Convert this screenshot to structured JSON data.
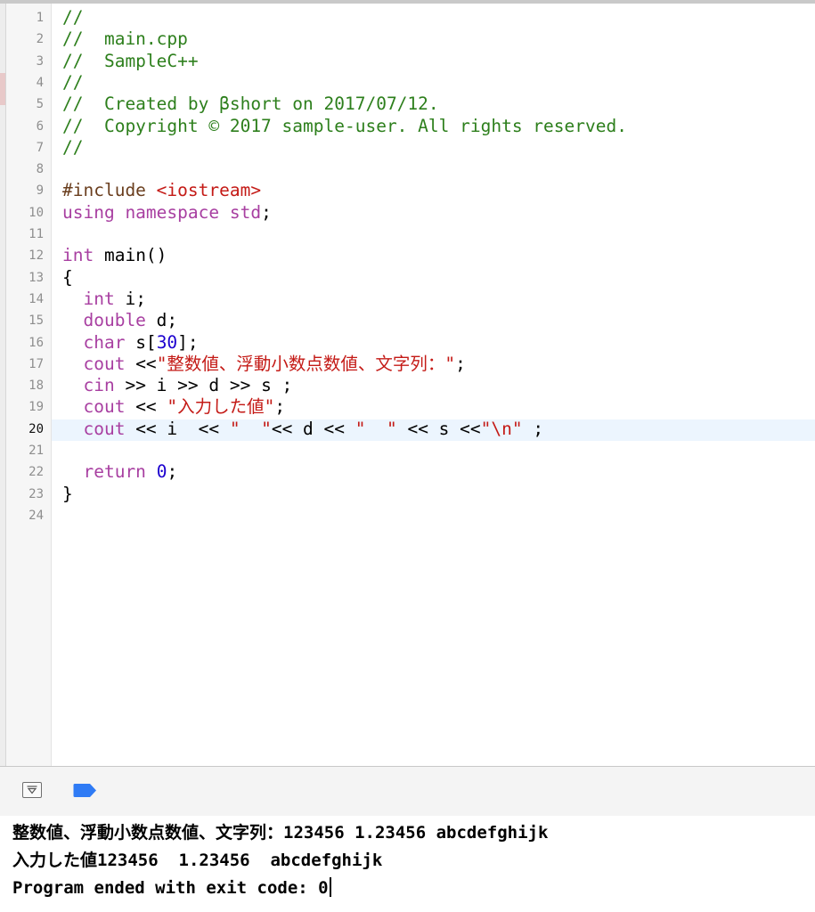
{
  "editor": {
    "current_line": 20,
    "lines": [
      {
        "n": "1",
        "segs": [
          {
            "t": "//",
            "c": "comment"
          }
        ]
      },
      {
        "n": "2",
        "segs": [
          {
            "t": "//  main.cpp",
            "c": "comment"
          }
        ]
      },
      {
        "n": "3",
        "segs": [
          {
            "t": "//  SampleC++",
            "c": "comment"
          }
        ]
      },
      {
        "n": "4",
        "segs": [
          {
            "t": "//",
            "c": "comment"
          }
        ]
      },
      {
        "n": "5",
        "segs": [
          {
            "t": "//  Created by βshort on 2017/07/12.",
            "c": "comment"
          }
        ]
      },
      {
        "n": "6",
        "segs": [
          {
            "t": "//  Copyright © 2017 sample-user. All rights reserved.",
            "c": "comment"
          }
        ]
      },
      {
        "n": "7",
        "segs": [
          {
            "t": "//",
            "c": "comment"
          }
        ]
      },
      {
        "n": "8",
        "segs": []
      },
      {
        "n": "9",
        "segs": [
          {
            "t": "#include ",
            "c": "pre"
          },
          {
            "t": "<iostream>",
            "c": "str"
          }
        ]
      },
      {
        "n": "10",
        "segs": [
          {
            "t": "using namespace std",
            "c": "kw"
          },
          {
            "t": ";",
            "c": "plain"
          }
        ]
      },
      {
        "n": "11",
        "segs": []
      },
      {
        "n": "12",
        "segs": [
          {
            "t": "int",
            "c": "kw"
          },
          {
            "t": " main()",
            "c": "plain"
          }
        ]
      },
      {
        "n": "13",
        "segs": [
          {
            "t": "{",
            "c": "plain"
          }
        ]
      },
      {
        "n": "14",
        "segs": [
          {
            "t": "  ",
            "c": "plain"
          },
          {
            "t": "int",
            "c": "kw"
          },
          {
            "t": " i;",
            "c": "plain"
          }
        ]
      },
      {
        "n": "15",
        "segs": [
          {
            "t": "  ",
            "c": "plain"
          },
          {
            "t": "double",
            "c": "kw"
          },
          {
            "t": " d;",
            "c": "plain"
          }
        ]
      },
      {
        "n": "16",
        "segs": [
          {
            "t": "  ",
            "c": "plain"
          },
          {
            "t": "char",
            "c": "kw"
          },
          {
            "t": " s[",
            "c": "plain"
          },
          {
            "t": "30",
            "c": "num"
          },
          {
            "t": "];",
            "c": "plain"
          }
        ]
      },
      {
        "n": "17",
        "segs": [
          {
            "t": "  ",
            "c": "plain"
          },
          {
            "t": "cout",
            "c": "kw"
          },
          {
            "t": " <<",
            "c": "plain"
          },
          {
            "t": "\"整数値、浮動小数点数値、文字列：\"",
            "c": "str"
          },
          {
            "t": ";",
            "c": "plain"
          }
        ]
      },
      {
        "n": "18",
        "segs": [
          {
            "t": "  ",
            "c": "plain"
          },
          {
            "t": "cin",
            "c": "kw"
          },
          {
            "t": " >> i >> d >> s ;",
            "c": "plain"
          }
        ]
      },
      {
        "n": "19",
        "segs": [
          {
            "t": "  ",
            "c": "plain"
          },
          {
            "t": "cout",
            "c": "kw"
          },
          {
            "t": " << ",
            "c": "plain"
          },
          {
            "t": "\"入力した値\"",
            "c": "str"
          },
          {
            "t": ";",
            "c": "plain"
          }
        ]
      },
      {
        "n": "20",
        "segs": [
          {
            "t": "  ",
            "c": "plain"
          },
          {
            "t": "cout",
            "c": "kw"
          },
          {
            "t": " << i  << ",
            "c": "plain"
          },
          {
            "t": "\"  \"",
            "c": "str"
          },
          {
            "t": "<< d << ",
            "c": "plain"
          },
          {
            "t": "\"  \"",
            "c": "str"
          },
          {
            "t": " << s <<",
            "c": "plain"
          },
          {
            "t": "\"\\n\"",
            "c": "str"
          },
          {
            "t": " ;",
            "c": "plain"
          }
        ]
      },
      {
        "n": "21",
        "segs": []
      },
      {
        "n": "22",
        "segs": [
          {
            "t": "  ",
            "c": "plain"
          },
          {
            "t": "return",
            "c": "kw"
          },
          {
            "t": " ",
            "c": "plain"
          },
          {
            "t": "0",
            "c": "num"
          },
          {
            "t": ";",
            "c": "plain"
          }
        ]
      },
      {
        "n": "23",
        "segs": [
          {
            "t": "}",
            "c": "plain"
          }
        ]
      },
      {
        "n": "24",
        "segs": []
      }
    ]
  },
  "toolbar": {
    "hide_debug_icon": "hide-debug-area-icon",
    "breakpoint_icon": "breakpoints-toggle-icon",
    "accent": "#2f7bf5"
  },
  "console": {
    "line1": "整数値、浮動小数点数値、文字列：123456 1.23456 abcdefghijk",
    "line2": "入力した値123456  1.23456  abcdefghijk",
    "line3": "Program ended with exit code: 0"
  }
}
